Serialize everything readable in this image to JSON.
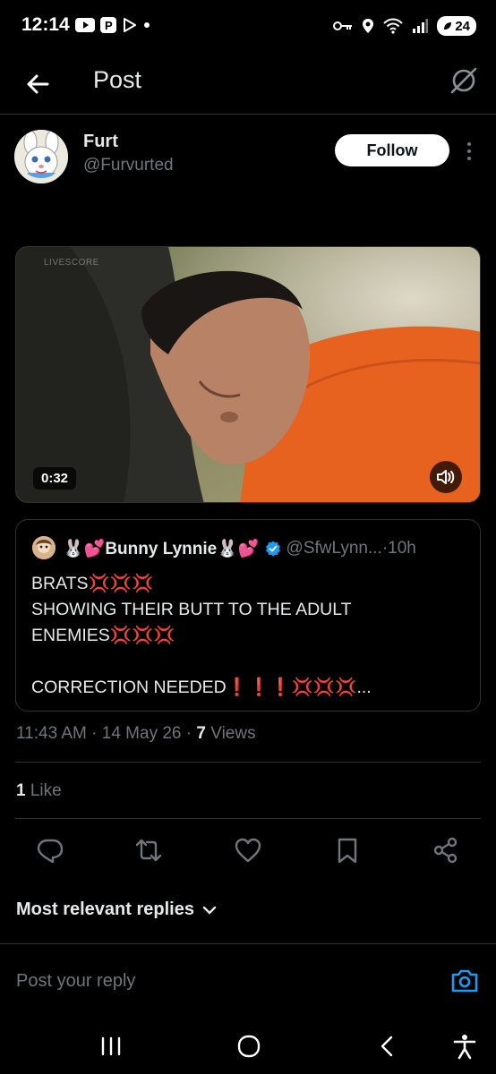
{
  "status_bar": {
    "time": "12:14",
    "battery": "24"
  },
  "header": {
    "title": "Post"
  },
  "author": {
    "name": "Furt",
    "handle": "@Furvurted",
    "follow_label": "Follow"
  },
  "video": {
    "duration": "0:32",
    "watermark": "LIVESCORE"
  },
  "quoted_post": {
    "name": "🐰💕Bunny Lynnie🐰💕",
    "handle": "@SfwLynn...",
    "separator": " · ",
    "time": "10h",
    "text": "BRATS💢💢💢\nSHOWING THEIR BUTT TO THE ADULT ENEMIES💢💢💢\n\nCORRECTION NEEDED❗❗❗💢💢💢..."
  },
  "post_meta": {
    "time": "11:43 AM",
    "date": "14 May 26",
    "views_count": "7",
    "views_label": "Views",
    "separator": " · "
  },
  "engagement": {
    "likes_count": "1",
    "likes_label": "Like"
  },
  "actions": [
    "reply-icon",
    "repost-icon",
    "like-icon",
    "bookmark-icon",
    "share-icon"
  ],
  "replies": {
    "sort_label": "Most relevant replies"
  },
  "reply_box": {
    "placeholder": "Post your reply"
  },
  "colors": {
    "background": "#000000",
    "text": "#e7e9ea",
    "muted": "#71767b",
    "accent": "#1d9bf0",
    "border": "#2f3336",
    "prisoner_orange": "#e8621f"
  }
}
